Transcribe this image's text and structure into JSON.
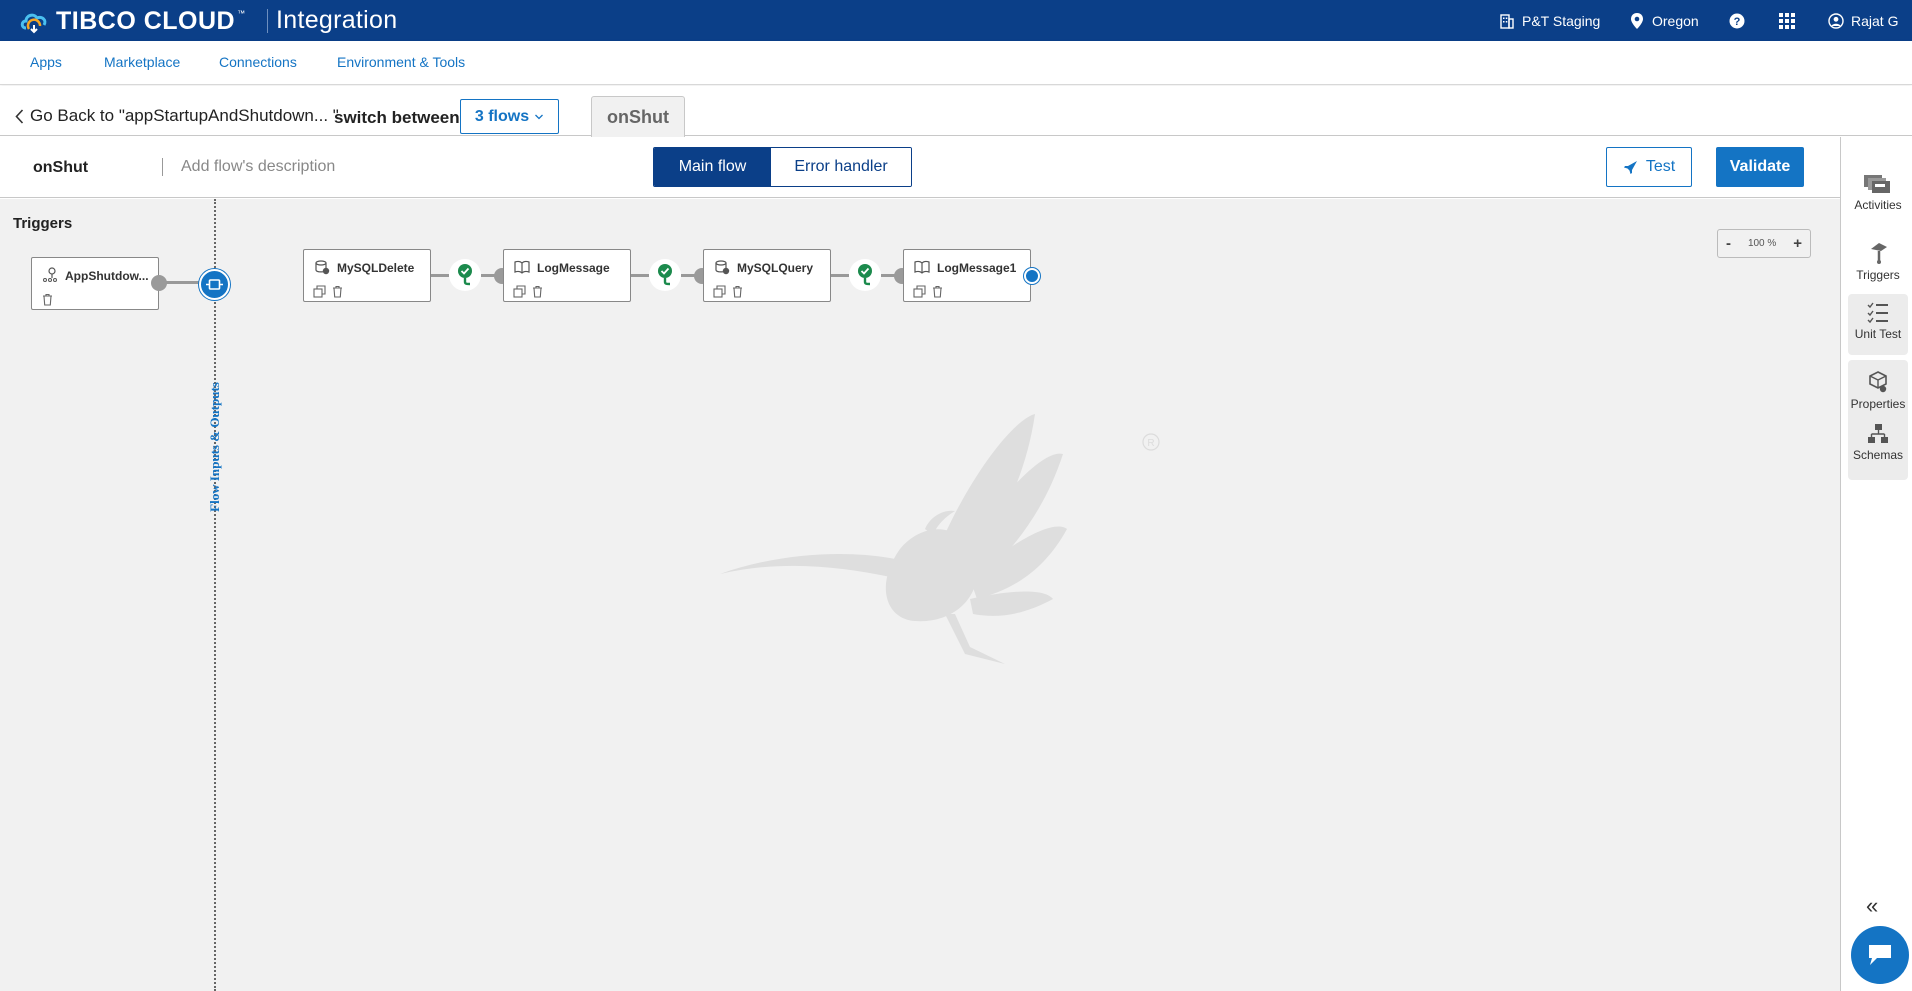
{
  "topbar": {
    "brand": "TIBCO CLOUD",
    "brand_tm": "™",
    "product": "Integration",
    "org": "P&T Staging",
    "region": "Oregon",
    "user": "Rajat G",
    "colors": {
      "background": "#0b3f88",
      "text": "#ffffff"
    }
  },
  "nav": {
    "items": [
      {
        "label": "Apps"
      },
      {
        "label": "Marketplace"
      },
      {
        "label": "Connections"
      },
      {
        "label": "Environment & Tools"
      }
    ]
  },
  "flowbar": {
    "back_label": "Go Back to \"appStartupAndShutdown... \"",
    "switch_label": "switch between",
    "flows_dropdown": "3 flows",
    "active_tab": "onShut"
  },
  "toolbar": {
    "flow_name": "onShut",
    "description_placeholder": "Add flow's description",
    "main_flow": "Main flow",
    "error_handler": "Error handler",
    "test": "Test",
    "validate": "Validate"
  },
  "canvas": {
    "triggers_title": "Triggers",
    "trigger": {
      "label": "AppShutdow...",
      "icon": "trigger-icon"
    },
    "io_label": "Flow Inputs & Outputs",
    "activities": [
      {
        "label": "MySQLDelete",
        "icon": "database-icon"
      },
      {
        "label": "LogMessage",
        "icon": "book-icon"
      },
      {
        "label": "MySQLQuery",
        "icon": "database-icon"
      },
      {
        "label": "LogMessage1",
        "icon": "book-icon"
      }
    ],
    "zoom": {
      "level": "100 %",
      "minus": "-",
      "plus": "+"
    },
    "colors": {
      "canvas": "#f1f1f1",
      "accent": "#1474c4",
      "success": "#1b8a4c"
    }
  },
  "rail": {
    "items": [
      {
        "label": "Activities"
      },
      {
        "label": "Triggers"
      },
      {
        "label": "Unit Test"
      },
      {
        "label": "Properties"
      },
      {
        "label": "Schemas"
      }
    ],
    "collapse": "«"
  }
}
